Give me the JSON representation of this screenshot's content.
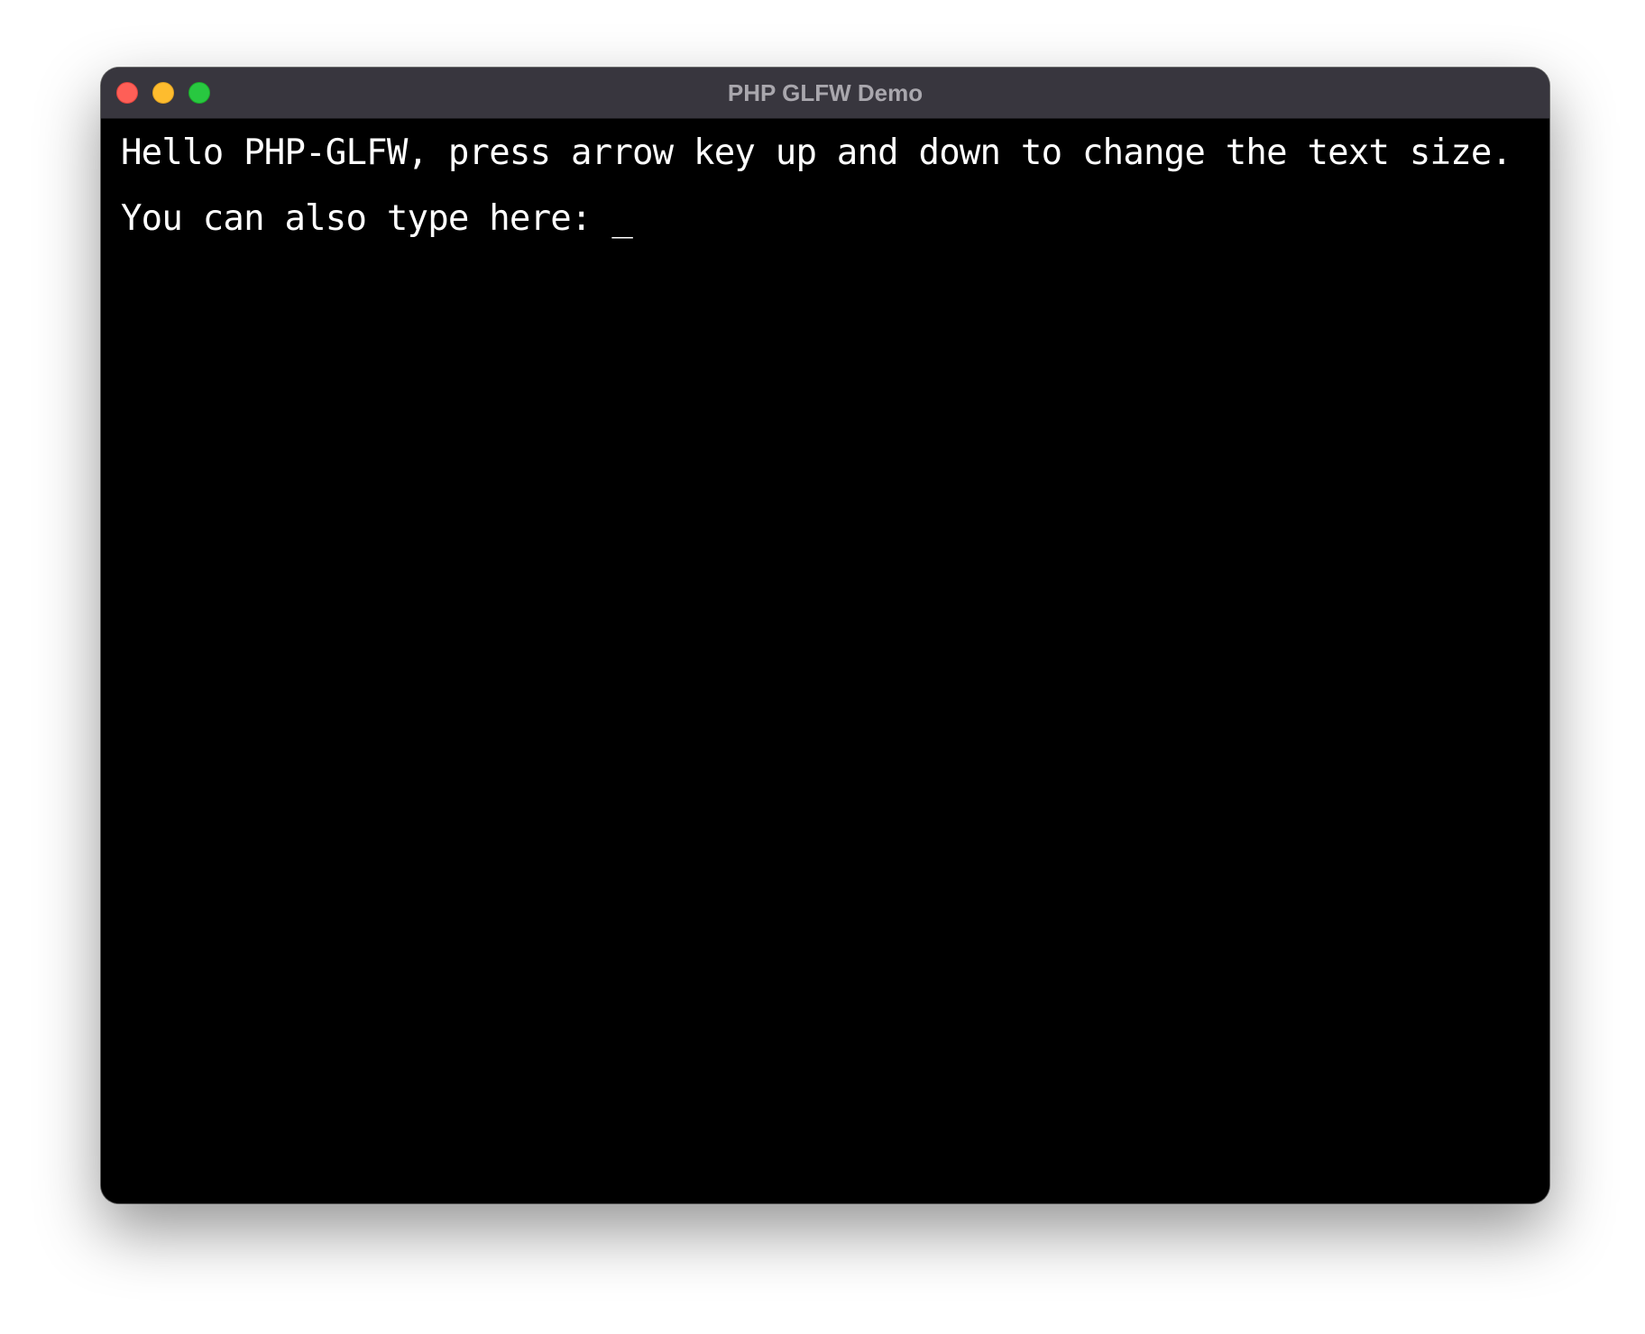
{
  "window": {
    "title": "PHP GLFW Demo"
  },
  "content": {
    "line1": "Hello PHP-GLFW, press arrow key up and down to change the text size.",
    "line2_prompt": "You can also type here: ",
    "cursor": "_"
  },
  "colors": {
    "titlebar": "#38363e",
    "background": "#000000",
    "text": "#ffffff",
    "close": "#fe5f57",
    "minimize": "#febc2e",
    "zoom": "#28c840"
  },
  "icons": {
    "close": "close-icon",
    "minimize": "minimize-icon",
    "zoom": "zoom-icon"
  }
}
